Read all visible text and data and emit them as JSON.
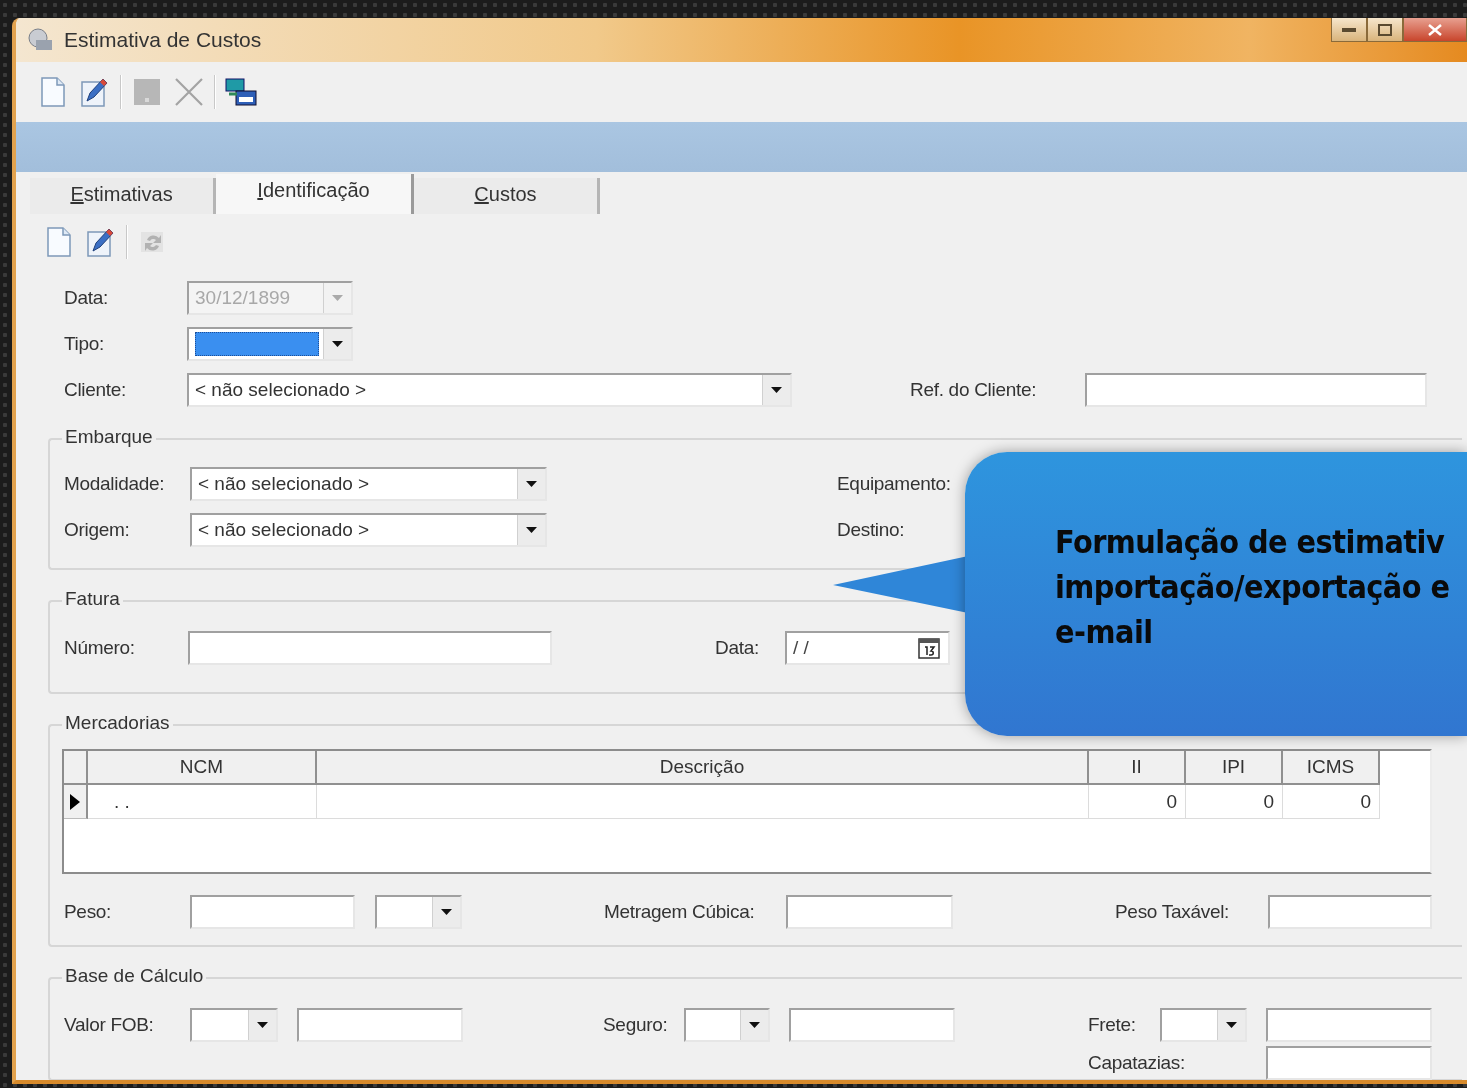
{
  "window": {
    "title": "Estimativa de Custos"
  },
  "toolbar": [
    {
      "kind": "new",
      "disabled": false
    },
    {
      "kind": "edit",
      "disabled": false
    },
    {
      "kind": "separator"
    },
    {
      "kind": "save",
      "disabled": true
    },
    {
      "kind": "delete",
      "disabled": true
    },
    {
      "kind": "separator"
    },
    {
      "kind": "transfer",
      "disabled": false
    }
  ],
  "tabs": [
    {
      "label": "Estimativas",
      "selected": false
    },
    {
      "label": "Identificação",
      "selected": true
    },
    {
      "label": "Custos",
      "selected": false
    }
  ],
  "subtoolbar": [
    {
      "kind": "new",
      "disabled": false
    },
    {
      "kind": "edit",
      "disabled": false
    },
    {
      "kind": "separator"
    },
    {
      "kind": "refresh",
      "disabled": true
    }
  ],
  "identificacao": {
    "data": {
      "label": "Data:",
      "value": "30/12/1899",
      "disabled": true
    },
    "tipo": {
      "label": "Tipo:",
      "focused": true
    },
    "cliente": {
      "label": "Cliente:",
      "value": "< não selecionado >"
    },
    "ref_cliente": {
      "label": "Ref. do Cliente:"
    }
  },
  "embarque": {
    "title": "Embarque",
    "modalidade": {
      "label": "Modalidade:",
      "value": "< não selecionado >"
    },
    "origem": {
      "label": "Origem:",
      "value": "< não selecionado >"
    },
    "equipamento": {
      "label": "Equipamento:"
    },
    "destino": {
      "label": "Destino:"
    }
  },
  "fatura": {
    "title": "Fatura",
    "numero": {
      "label": "Número:"
    },
    "data": {
      "label": "Data:",
      "value": "/ /"
    }
  },
  "mercadorias": {
    "title": "Mercadorias",
    "columns": [
      "NCM",
      "Descrição",
      "II",
      "IPI",
      "ICMS"
    ],
    "rows": [
      {
        "current": true,
        "ncm": ". .",
        "ii": "0",
        "ipi": "0",
        "icms": "0"
      }
    ],
    "peso": {
      "label": "Peso:"
    },
    "metragem": {
      "label": "Metragem Cúbica:"
    },
    "peso_taxavel": {
      "label": "Peso Taxável:"
    }
  },
  "base_calculo": {
    "title": "Base de Cálculo",
    "valor_fob": {
      "label": "Valor FOB:"
    },
    "seguro": {
      "label": "Seguro:"
    },
    "frete": {
      "label": "Frete:"
    },
    "capatazias": {
      "label": "Capatazias:"
    }
  },
  "callout": {
    "lines": [
      "Formulação de estimativ",
      "importação/exportação e",
      "e-mail"
    ]
  }
}
